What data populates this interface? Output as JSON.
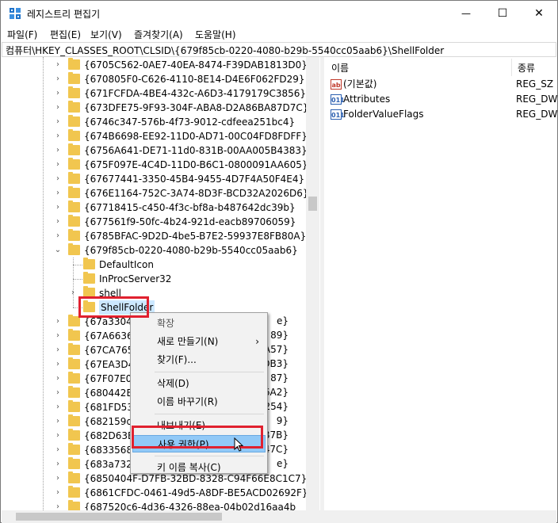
{
  "window": {
    "title": "레지스트리 편집기",
    "controls": {
      "minimize": "—",
      "maximize": "☐",
      "close": "✕"
    }
  },
  "menu": [
    "파일(F)",
    "편집(E)",
    "보기(V)",
    "즐겨찾기(A)",
    "도움말(H)"
  ],
  "address": "컴퓨터\\HKEY_CLASSES_ROOT\\CLSID\\{679f85cb-0220-4080-b29b-5540cc05aab6}\\ShellFolder",
  "tree": {
    "expand_glyph": "›",
    "collapse_glyph": "⌄",
    "keys_before": [
      "{6705C562-0AE7-40EA-8474-F39DAB1813D0}",
      "{670805F0-C626-4110-8E14-D4E6F062FD29}",
      "{671FCFDA-4BE4-432c-A6D3-4179179C3856}",
      "{673DFE75-9F93-304F-ABA8-D2A86BA87D7C}",
      "{6746c347-576b-4f73-9012-cdfeea251bc4}",
      "{674B6698-EE92-11D0-AD71-00C04FD8FDFF}",
      "{6756A641-DE71-11d0-831B-00AA005B4383}",
      "{675F097E-4C4D-11D0-B6C1-0800091AA605}",
      "{67677441-3350-45B4-9455-4D7F4A50F4E4}",
      "{676E1164-752C-3A74-8D3F-BCD32A2026D6}",
      "{67718415-c450-4f3c-bf8a-b487642dc39b}",
      "{677561f9-50fc-4b24-921d-eacb89706059}",
      "{6785BFAC-9D2D-4be5-B7E2-59937E8FB80A}"
    ],
    "expanded_key": "{679f85cb-0220-4080-b29b-5540cc05aab6}",
    "children": [
      "DefaultIcon",
      "InProcServer32",
      "shell"
    ],
    "selected_child": "ShellFolder",
    "keys_after": [
      "{67a33041",
      "{67A66362",
      "{67CA7650",
      "{67EA3D48",
      "{67F07E00",
      "{680442B0",
      "{681FD532",
      "{682159d9",
      "{682D63B8",
      "{6833568E",
      "{683a732e",
      "{6850404F-D7FB-32BD-8328-C94F66E8C1C7}",
      "{6861CFDC-0461-49d5-A8DF-BE5ACD02692F}",
      "{687520c6-4d36-4326-88ea-04b02d16aa4b"
    ],
    "keys_after_tail": [
      "e}",
      "89}",
      "A57}",
      "DB3}",
      "87}",
      "6A2}",
      "254}",
      "9}",
      "B7B}",
      "47C}",
      "e}"
    ]
  },
  "values": {
    "col_name": "이름",
    "col_type": "종류",
    "rows": [
      {
        "icon": "ab",
        "name": "(기본값)",
        "type": "REG_SZ"
      },
      {
        "icon": "011",
        "name": "Attributes",
        "type": "REG_DWO"
      },
      {
        "icon": "011",
        "name": "FolderValueFlags",
        "type": "REG_DWO"
      }
    ]
  },
  "context_menu": {
    "items": [
      {
        "label": "확장",
        "disabled": true
      },
      {
        "label": "새로 만들기(N)",
        "submenu": "›"
      },
      {
        "label": "찾기(F)..."
      },
      {
        "separator": true
      },
      {
        "label": "삭제(D)"
      },
      {
        "label": "이름 바꾸기(R)"
      },
      {
        "separator": true
      },
      {
        "label": "내보내기(E)"
      },
      {
        "label": "사용 권한(P)...",
        "highlighted": true
      },
      {
        "separator": true
      },
      {
        "label": "키 이름 복사(C)"
      }
    ]
  },
  "colors": {
    "folder": "#f1c64f",
    "selection": "#cce8ff",
    "menu_highlight": "#91c9f7",
    "annotation_red": "#e0212f",
    "dword_icon": "#2b5fb0",
    "string_icon": "#c0392b"
  }
}
